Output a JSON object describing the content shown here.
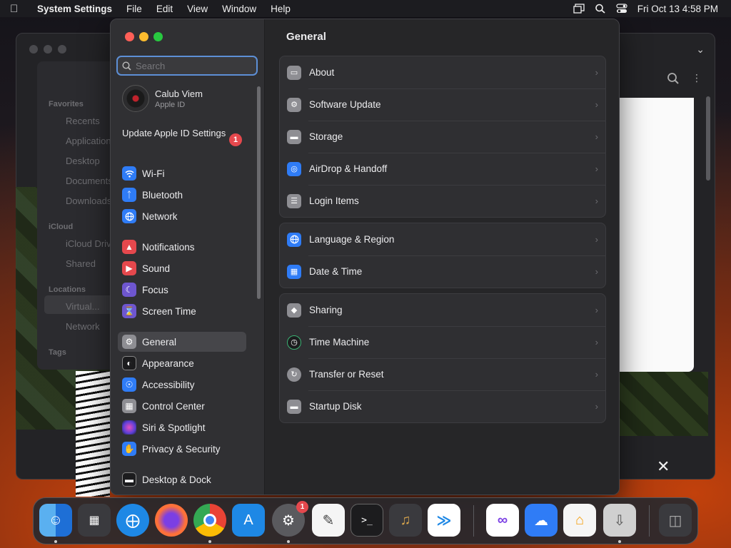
{
  "menubar": {
    "app_name": "System Settings",
    "menus": [
      "File",
      "Edit",
      "View",
      "Window",
      "Help"
    ],
    "datetime": "Fri Oct 13  4:58 PM"
  },
  "finder_sidebar": {
    "favorites_header": "Favorites",
    "favorites": [
      "Recents",
      "Applications",
      "Desktop",
      "Documents",
      "Downloads"
    ],
    "icloud_header": "iCloud",
    "icloud": [
      "iCloud Drive",
      "Shared"
    ],
    "locations_header": "Locations",
    "locations": [
      "Virtual...",
      "Network"
    ],
    "tags_header": "Tags"
  },
  "search": {
    "placeholder": "Search",
    "value": ""
  },
  "account": {
    "name": "Calub Viem",
    "subtitle": "Apple ID",
    "update_label": "Update Apple ID Settings",
    "update_badge": "1"
  },
  "sidebar": {
    "items": [
      {
        "label": "Wi-Fi",
        "icon": "wifi-icon",
        "color": "#2f7cf6"
      },
      {
        "label": "Bluetooth",
        "icon": "bluetooth-icon",
        "color": "#2f7cf6"
      },
      {
        "label": "Network",
        "icon": "globe-icon",
        "color": "#2f7cf6"
      },
      {
        "label": "Notifications",
        "icon": "bell-icon",
        "color": "#e5484d"
      },
      {
        "label": "Sound",
        "icon": "speaker-icon",
        "color": "#e5484d"
      },
      {
        "label": "Focus",
        "icon": "moon-icon",
        "color": "#6e56cf"
      },
      {
        "label": "Screen Time",
        "icon": "hourglass-icon",
        "color": "#6e56cf"
      },
      {
        "label": "General",
        "icon": "gear-icon",
        "color": "#8e8e93"
      },
      {
        "label": "Appearance",
        "icon": "appearance-icon",
        "color": "#1c1c1e"
      },
      {
        "label": "Accessibility",
        "icon": "accessibility-icon",
        "color": "#2f7cf6"
      },
      {
        "label": "Control Center",
        "icon": "control-center-icon",
        "color": "#8e8e93"
      },
      {
        "label": "Siri & Spotlight",
        "icon": "siri-icon",
        "color": "#b54fd1"
      },
      {
        "label": "Privacy & Security",
        "icon": "hand-icon",
        "color": "#2f7cf6"
      },
      {
        "label": "Desktop & Dock",
        "icon": "dock-icon",
        "color": "#1c1c1e"
      }
    ],
    "selected": "General"
  },
  "content": {
    "title": "General",
    "groups": [
      [
        {
          "label": "About",
          "icon": "computer-icon",
          "color": "#8e8e93"
        },
        {
          "label": "Software Update",
          "icon": "gear-badge-icon",
          "color": "#8e8e93"
        },
        {
          "label": "Storage",
          "icon": "drive-icon",
          "color": "#8e8e93"
        },
        {
          "label": "AirDrop & Handoff",
          "icon": "airdrop-icon",
          "color": "#2f7cf6"
        },
        {
          "label": "Login Items",
          "icon": "list-icon",
          "color": "#8e8e93"
        }
      ],
      [
        {
          "label": "Language & Region",
          "icon": "globe-icon",
          "color": "#2f7cf6"
        },
        {
          "label": "Date & Time",
          "icon": "calendar-icon",
          "color": "#2f7cf6"
        }
      ],
      [
        {
          "label": "Sharing",
          "icon": "sharing-icon",
          "color": "#8e8e93"
        },
        {
          "label": "Time Machine",
          "icon": "clock-icon",
          "color": "#1c1c1e"
        },
        {
          "label": "Transfer or Reset",
          "icon": "reset-icon",
          "color": "#8e8e93"
        },
        {
          "label": "Startup Disk",
          "icon": "disk-icon",
          "color": "#8e8e93"
        }
      ]
    ]
  },
  "dock": {
    "apps": [
      {
        "name": "Finder",
        "icon": "finder-icon",
        "color": "#1e88e5",
        "running": true
      },
      {
        "name": "Launchpad",
        "icon": "launchpad-icon",
        "color": "#3a3a3e",
        "running": false
      },
      {
        "name": "Safari",
        "icon": "safari-icon",
        "color": "#1e88e5",
        "running": false
      },
      {
        "name": "Firefox",
        "icon": "firefox-icon",
        "color": "#3a3a3e",
        "running": false
      },
      {
        "name": "Chrome",
        "icon": "chrome-icon",
        "color": "#ffffff",
        "running": true
      },
      {
        "name": "App Store",
        "icon": "app-store-icon",
        "color": "#1e88e5",
        "running": false
      },
      {
        "name": "System Settings",
        "icon": "settings-icon",
        "color": "#5a5a5e",
        "running": true,
        "badge": "1"
      },
      {
        "name": "TextEdit",
        "icon": "textedit-icon",
        "color": "#f5f5f5",
        "running": false
      },
      {
        "name": "Terminal",
        "icon": "terminal-icon",
        "color": "#1c1c1e",
        "running": false
      },
      {
        "name": "GarageBand",
        "icon": "guitar-icon",
        "color": "#3a3a3e",
        "running": false
      },
      {
        "name": "VS Code",
        "icon": "vscode-icon",
        "color": "#ffffff",
        "running": false
      },
      {
        "name": "Visual Studio",
        "icon": "visual-studio-icon",
        "color": "#ffffff",
        "running": false
      },
      {
        "name": "Weather",
        "icon": "weather-icon",
        "color": "#2f7cf6",
        "running": false
      },
      {
        "name": "Home",
        "icon": "home-icon",
        "color": "#f5f5f5",
        "running": false
      },
      {
        "name": "Downloads",
        "icon": "downloads-icon",
        "color": "#d0d0d0",
        "running": true
      },
      {
        "name": "Trash",
        "icon": "trash-icon",
        "color": "#3a3a3e",
        "running": false
      }
    ]
  }
}
